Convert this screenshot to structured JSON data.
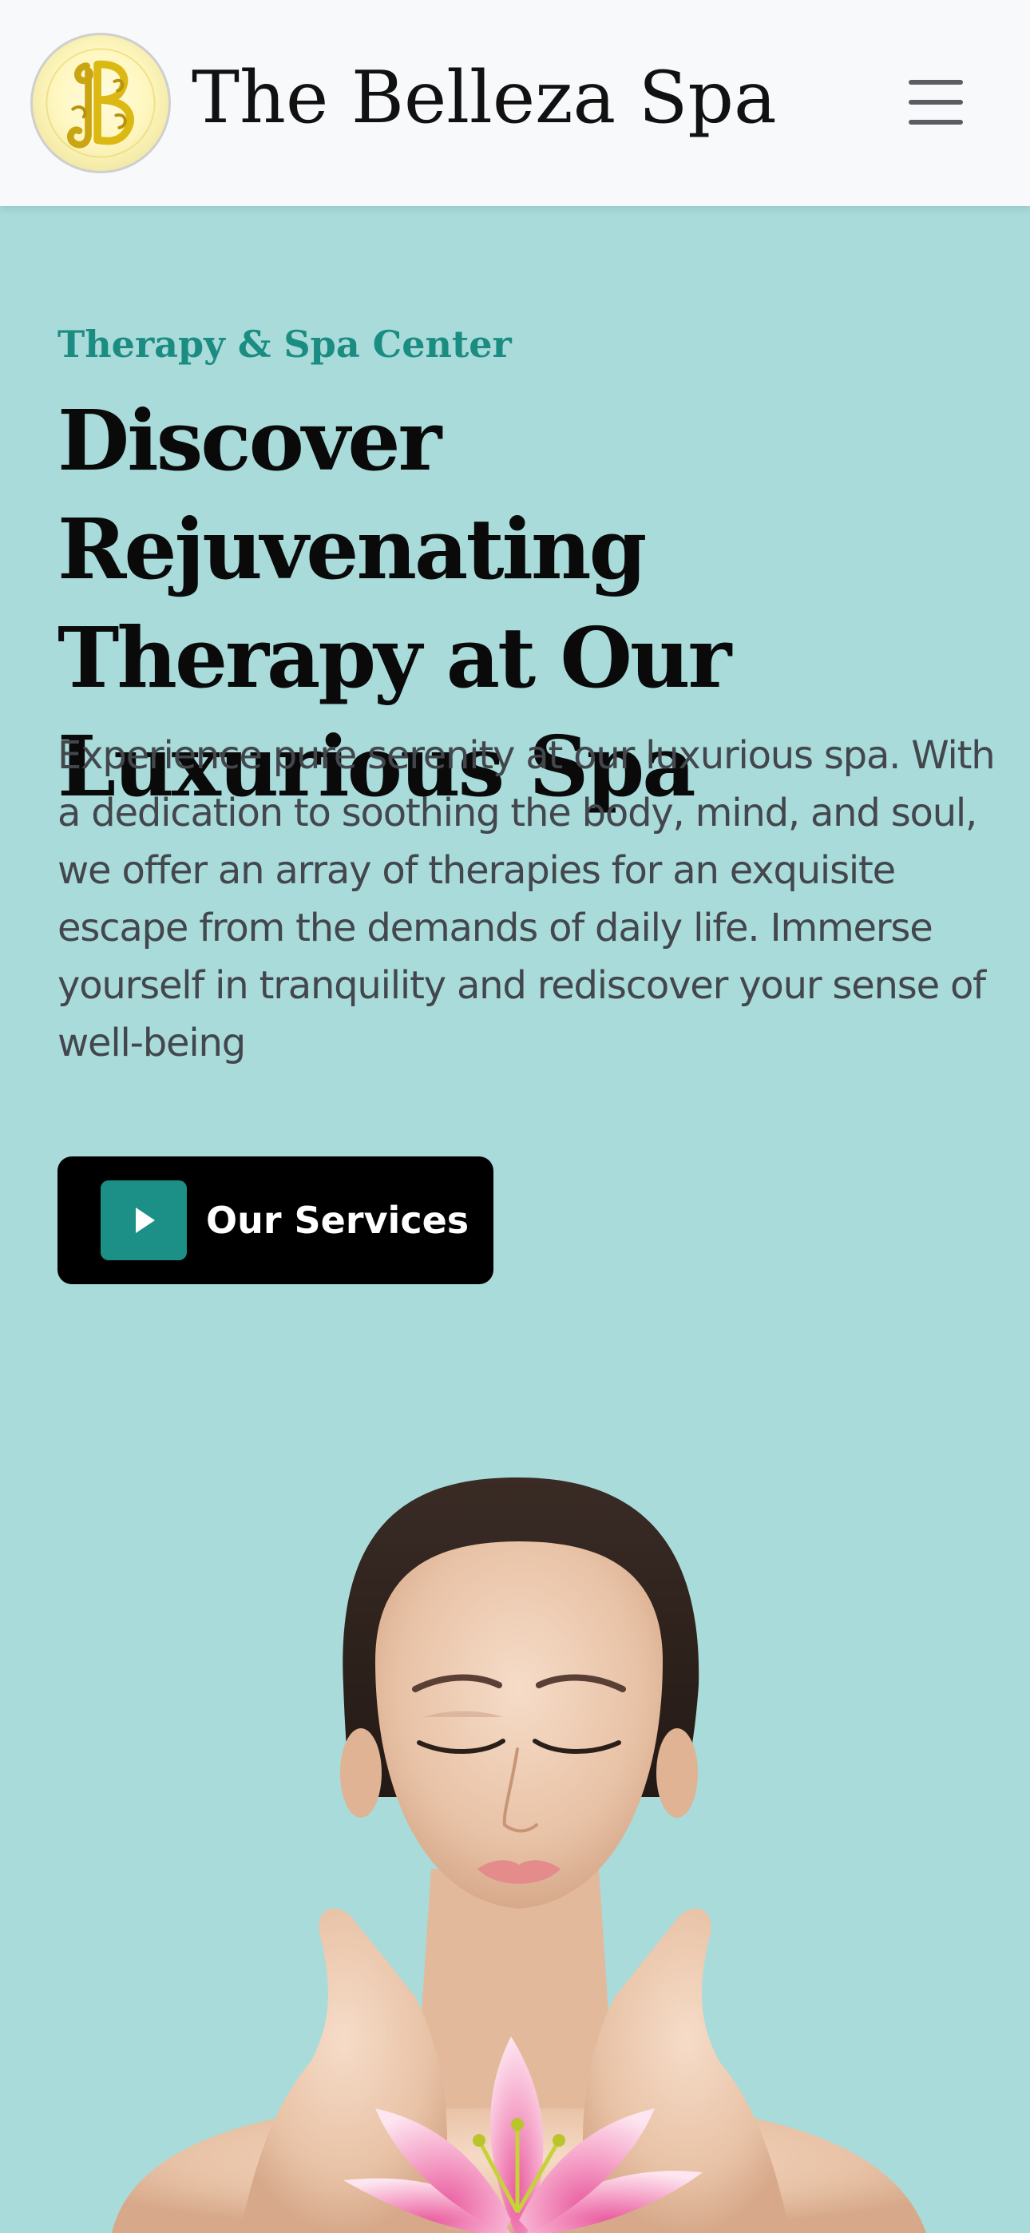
{
  "header": {
    "brand_name": "The Belleza Spa",
    "logo_icon": "belleza-monogram-logo",
    "menu_icon": "hamburger-menu-icon"
  },
  "hero": {
    "eyebrow": "Therapy & Spa Center",
    "headline": "Discover Rejuvenating Therapy at Our Luxurious Spa",
    "description": "Experience pure serenity at our luxurious spa. With a dedication to soothing the body, mind, and soul, we offer an array of therapies for an exquisite escape from the demands of daily life. Immerse yourself in tranquility and rediscover your sense of well-being",
    "cta_label": "Our Services",
    "cta_icon": "play-icon",
    "image_subject": "woman-with-lily-photo"
  },
  "colors": {
    "hero_background": "#a8dbd9",
    "navbar_background": "#f8f9fb",
    "accent": "#1a8c82",
    "cta_background": "#000000",
    "cta_icon_background": "#1c9087"
  }
}
